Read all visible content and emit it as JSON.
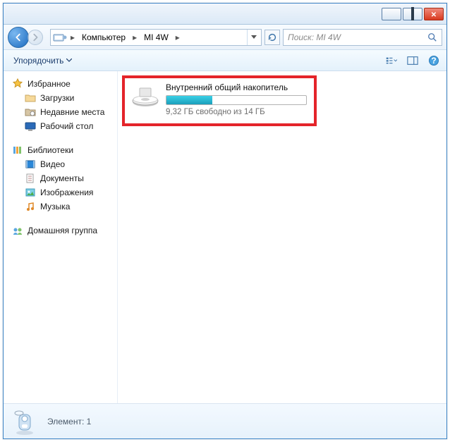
{
  "titlebar": {},
  "nav": {
    "path": [
      {
        "label": "Компьютер"
      },
      {
        "label": "MI 4W"
      }
    ]
  },
  "search": {
    "placeholder": "Поиск: MI 4W"
  },
  "toolbar": {
    "organize": "Упорядочить"
  },
  "sidebar": {
    "favorites": {
      "title": "Избранное",
      "items": [
        "Загрузки",
        "Недавние места",
        "Рабочий стол"
      ]
    },
    "libraries": {
      "title": "Библиотеки",
      "items": [
        "Видео",
        "Документы",
        "Изображения",
        "Музыка"
      ]
    },
    "homegroup": {
      "title": "Домашняя группа"
    }
  },
  "content": {
    "drive": {
      "name": "Внутренний общий накопитель",
      "free_text": "9,32 ГБ свободно из 14 ГБ",
      "fill_percent": 33
    }
  },
  "statusbar": {
    "text": "Элемент: 1"
  }
}
